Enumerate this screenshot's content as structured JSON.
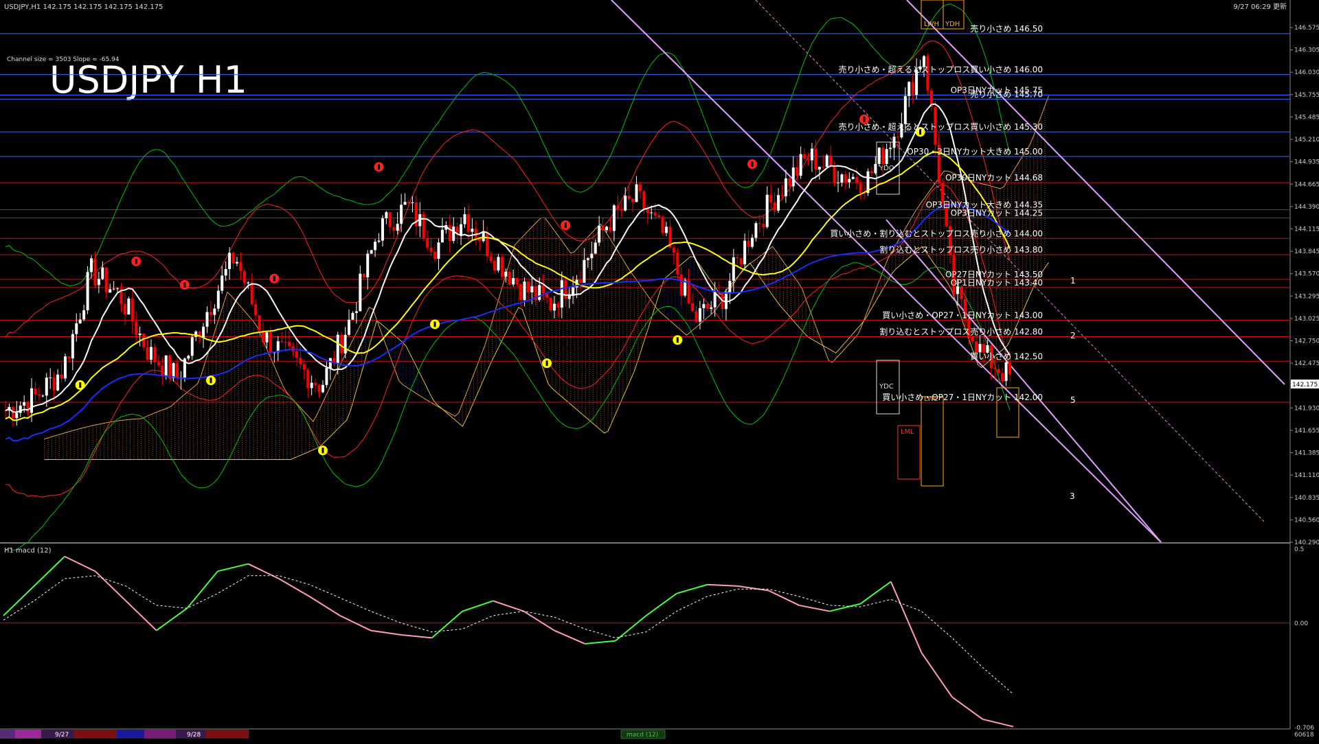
{
  "window": {
    "header_info": "USDJPY,H1  142.175 142.175 142.175 142.175",
    "time_label": "9/27 06:29 更新",
    "channel_info": "Channel size = 3503 Slope = -65.94",
    "big_title": "USDJPY H1"
  },
  "colors": {
    "background": "#000000",
    "bull": "#ffffff",
    "bear": "#ff0000",
    "level_blue": "#3b6cff",
    "level_red": "#d01010",
    "sma_white": "#ffffff",
    "sma_yellow": "#ffff00",
    "sma_blue": "#1a2cff",
    "band_red": "#ff2020",
    "band_green": "#00c000",
    "kumo_blue": "#1b3fd8",
    "kumo_orange": "#e07a3a",
    "channel_violet": "#e0a0ff",
    "macd_green": "#40ff40",
    "macd_pink": "#ff9bc8",
    "price_tag": "#ffffff"
  },
  "chart_data": [
    {
      "type": "candlestick",
      "title": "USDJPY H1",
      "price_axis": {
        "ticks": [
          "146.575",
          "146.305",
          "146.030",
          "145.755",
          "145.485",
          "145.210",
          "144.935",
          "144.665",
          "144.390",
          "144.115",
          "143.845",
          "143.570",
          "143.295",
          "143.025",
          "142.750",
          "142.475",
          "142.175",
          "141.930",
          "141.655",
          "141.385",
          "141.110",
          "140.835",
          "140.560",
          "140.290"
        ],
        "ylim": [
          140.29,
          146.575
        ],
        "current_price": "142.175"
      },
      "x_labels": [
        "9/27",
        "9/28"
      ],
      "ohlc_close_path": [
        141.9,
        142.05,
        142.4,
        143.6,
        143.3,
        142.6,
        142.3,
        143.1,
        143.8,
        142.8,
        142.5,
        142.2,
        143.0,
        144.1,
        144.4,
        143.9,
        144.3,
        143.8,
        143.4,
        143.2,
        143.6,
        144.2,
        144.5,
        144.0,
        143.0,
        143.3,
        144.1,
        144.6,
        145.0,
        144.8,
        144.7,
        145.3,
        146.3,
        143.4,
        142.6,
        142.3
      ],
      "horizontal_levels": [
        {
          "price": 146.5,
          "label": "売り小さめ 146.50",
          "color": "blue"
        },
        {
          "price": 146.0,
          "label": "売り小さめ・超えるとストップロス買い小さめ 146.00",
          "color": "blue"
        },
        {
          "price": 145.75,
          "label": "OP3日NYカット 145.75",
          "color": "blue"
        },
        {
          "price": 145.7,
          "label": "売り小さめ 145.70",
          "color": "blue"
        },
        {
          "price": 145.3,
          "label": "売り小さめ・超えるとストップロス買い小さめ 145.30",
          "color": "blue"
        },
        {
          "price": 145.0,
          "label": "OP30・3日NYカット大きめ 145.00",
          "color": "blue"
        },
        {
          "price": 144.68,
          "label": "OP30日NYカット 144.68",
          "color": "red"
        },
        {
          "price": 144.35,
          "label": "OP3日NYカット大きめ 144.35",
          "color": "red"
        },
        {
          "price": 144.25,
          "label": "OP3日NYカット 144.25",
          "color": "red"
        },
        {
          "price": 144.0,
          "label": "買い小さめ・割り込むとストップロス売り小さめ 144.00",
          "color": "red"
        },
        {
          "price": 143.8,
          "label": "割り込むとストップロス売り小さめ 143.80",
          "color": "red"
        },
        {
          "price": 143.5,
          "label": "OP27日NYカット 143.50",
          "color": "red"
        },
        {
          "price": 143.4,
          "label": "OP1日NYカット 143.40",
          "color": "red"
        },
        {
          "price": 143.0,
          "label": "買い小さめ・OP27・1日NYカット 143.00",
          "color": "red"
        },
        {
          "price": 142.8,
          "label": "割り込むとストップロス売り小さめ 142.80",
          "color": "red"
        },
        {
          "price": 142.5,
          "label": "買い小さめ 142.50",
          "color": "red"
        },
        {
          "price": 142.0,
          "label": "買い小さめ・OP27・1日NYカット 142.00",
          "color": "red"
        }
      ],
      "box_labels": [
        "LWH",
        "YDH",
        "YDO",
        "YDC",
        "LML",
        "LWL"
      ],
      "channel_numbers": [
        "1",
        "2",
        "5",
        "3"
      ]
    },
    {
      "type": "line",
      "title": "H1  macd (12)",
      "yticks": [
        "0.5",
        "0.00",
        "-0.706"
      ],
      "ylim": [
        -0.706,
        0.5
      ],
      "series": [
        {
          "values": [
            0.05,
            0.25,
            0.45,
            0.35,
            0.15,
            -0.05,
            0.1,
            0.35,
            0.4,
            0.3,
            0.18,
            0.05,
            -0.05,
            -0.08,
            -0.1,
            0.08,
            0.15,
            0.08,
            -0.05,
            -0.14,
            -0.12,
            0.05,
            0.2,
            0.26,
            0.25,
            0.22,
            0.12,
            0.08,
            0.13,
            0.28,
            -0.2,
            -0.5,
            -0.65,
            -0.7
          ]
        },
        {
          "values": [
            0.02,
            0.15,
            0.3,
            0.32,
            0.25,
            0.12,
            0.1,
            0.2,
            0.32,
            0.32,
            0.26,
            0.17,
            0.08,
            0.0,
            -0.06,
            -0.04,
            0.05,
            0.08,
            0.04,
            -0.04,
            -0.1,
            -0.06,
            0.08,
            0.18,
            0.23,
            0.23,
            0.18,
            0.12,
            0.11,
            0.16,
            0.08,
            -0.1,
            -0.3,
            -0.48
          ]
        }
      ]
    }
  ],
  "bottom_bar": {
    "dates": [
      "9/27",
      "9/28"
    ],
    "macd_tab": "macd (12)",
    "corner": "60618"
  }
}
